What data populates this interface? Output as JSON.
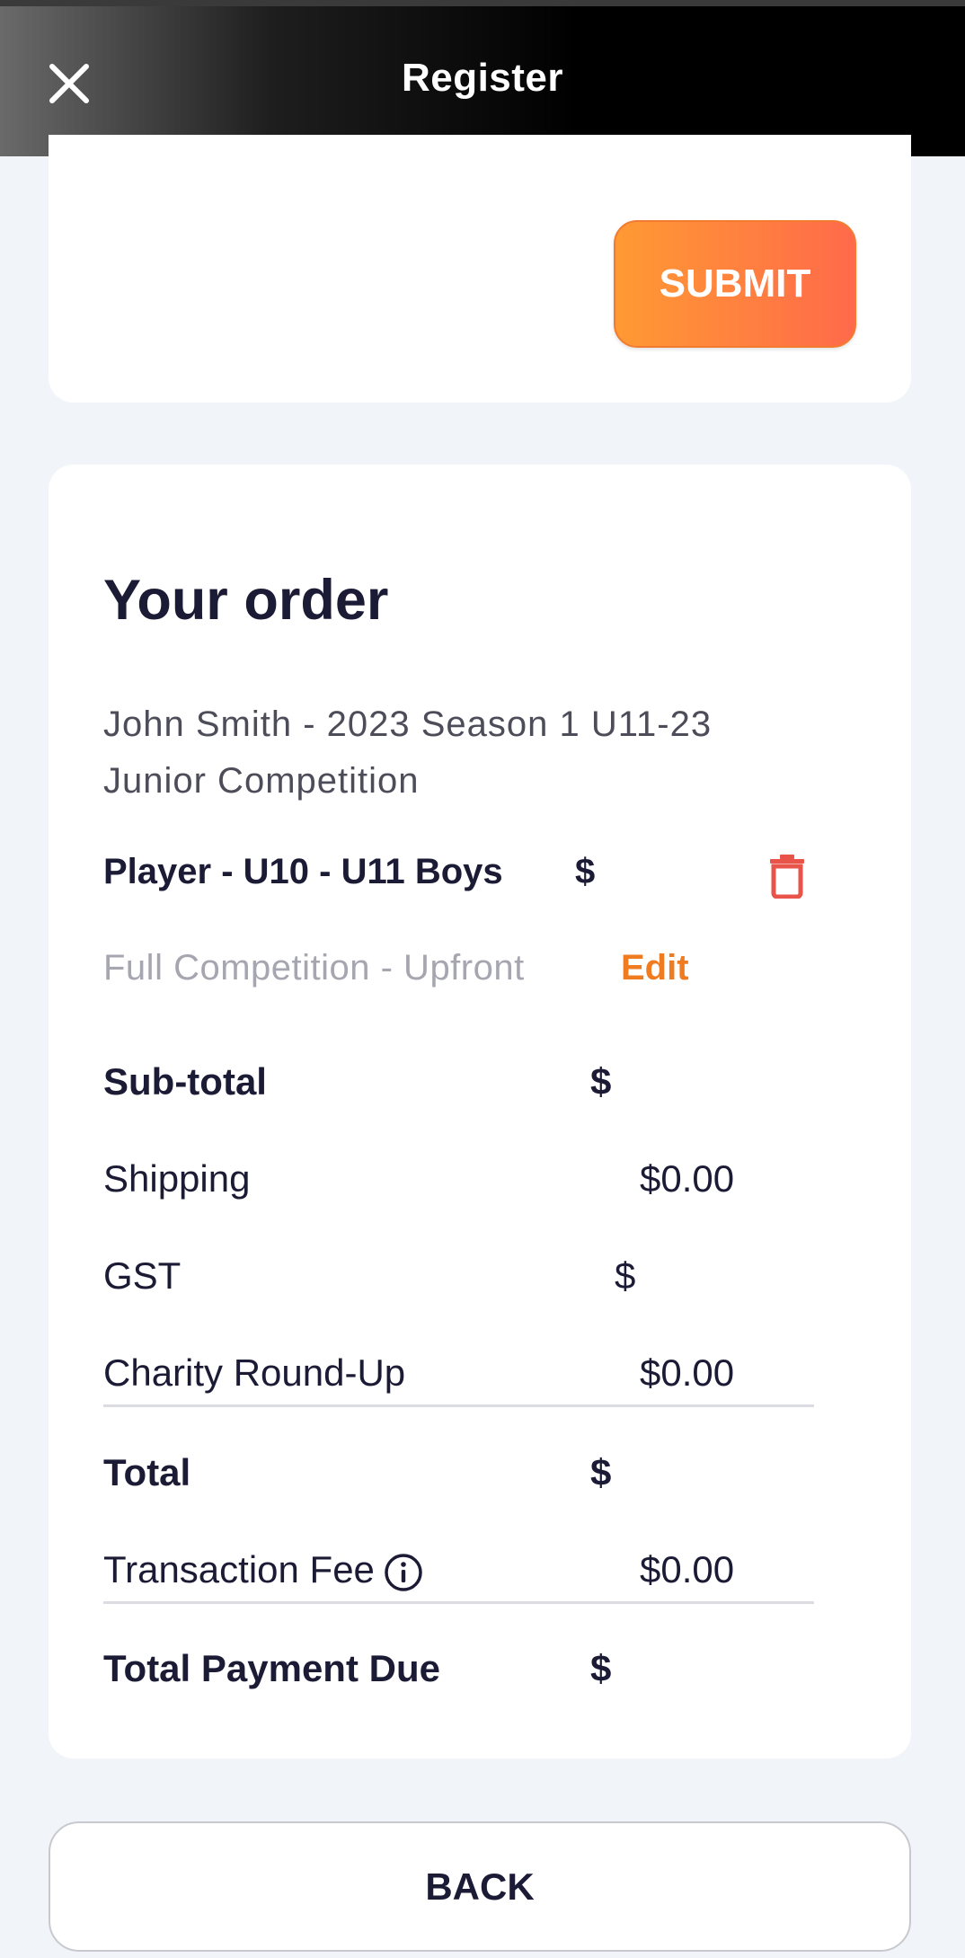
{
  "header": {
    "title": "Register",
    "close_icon": "close-icon"
  },
  "submit": {
    "label": "SUBMIT"
  },
  "order": {
    "title": "Your order",
    "description": "John Smith - 2023 Season 1 U11-23 Junior Competition",
    "item": {
      "name": "Player - U10 - U11 Boys",
      "price": "$",
      "option": "Full Competition - Upfront",
      "edit_label": "Edit",
      "delete_icon": "trash-icon"
    },
    "summary": {
      "subtotal_label": "Sub-total",
      "subtotal_value": "$",
      "shipping_label": "Shipping",
      "shipping_value": "$0.00",
      "gst_label": "GST",
      "gst_value": "$",
      "charity_label": "Charity Round-Up",
      "charity_value": "$0.00",
      "total_label": "Total",
      "total_value": "$",
      "fee_label": "Transaction Fee",
      "fee_value": "$0.00",
      "due_label": "Total Payment Due",
      "due_value": "$"
    }
  },
  "back": {
    "label": "BACK"
  },
  "colors": {
    "accent": "#f07c22",
    "danger": "#e8534a",
    "text": "#1b1b36"
  }
}
